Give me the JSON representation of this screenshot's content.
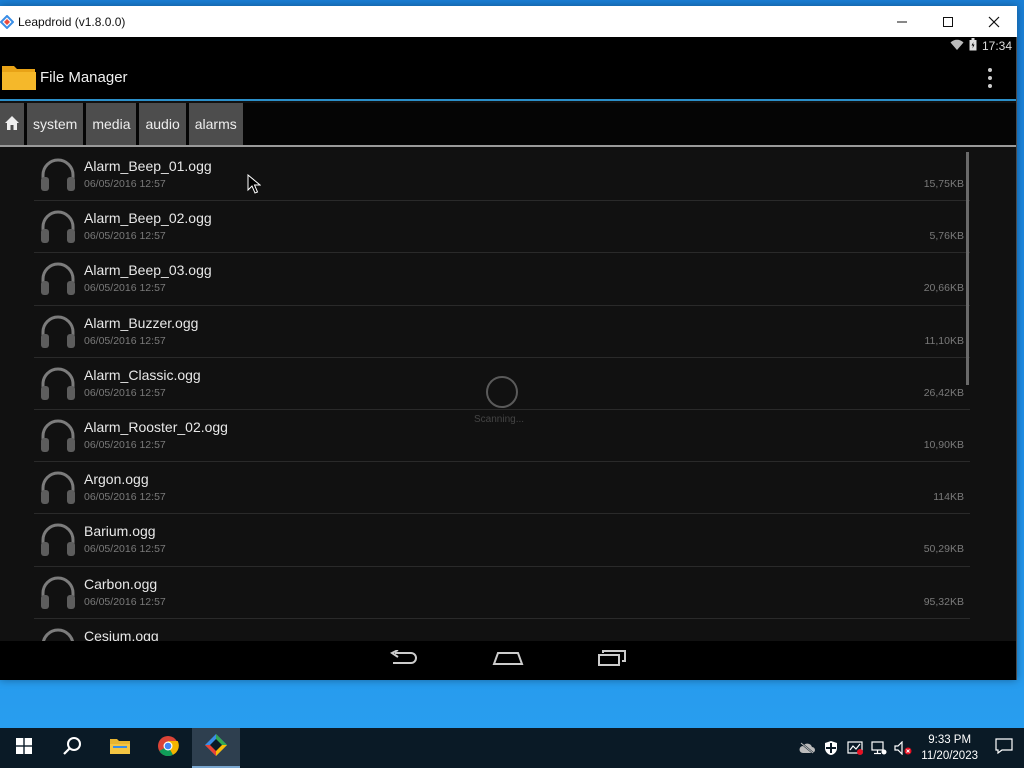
{
  "window": {
    "title": "Leapdroid (v1.8.0.0)",
    "controls": {
      "minimize": "─",
      "maximize": "☐",
      "close": "✕"
    }
  },
  "status_bar": {
    "time": "17:34"
  },
  "action_bar": {
    "title": "File Manager"
  },
  "breadcrumb": [
    "system",
    "media",
    "audio",
    "alarms"
  ],
  "files": [
    {
      "name": "Alarm_Beep_01.ogg",
      "date": "06/05/2016 12:57",
      "size": "15,75KB"
    },
    {
      "name": "Alarm_Beep_02.ogg",
      "date": "06/05/2016 12:57",
      "size": "5,76KB"
    },
    {
      "name": "Alarm_Beep_03.ogg",
      "date": "06/05/2016 12:57",
      "size": "20,66KB"
    },
    {
      "name": "Alarm_Buzzer.ogg",
      "date": "06/05/2016 12:57",
      "size": "11,10KB"
    },
    {
      "name": "Alarm_Classic.ogg",
      "date": "06/05/2016 12:57",
      "size": "26,42KB"
    },
    {
      "name": "Alarm_Rooster_02.ogg",
      "date": "06/05/2016 12:57",
      "size": "10,90KB"
    },
    {
      "name": "Argon.ogg",
      "date": "06/05/2016 12:57",
      "size": "114KB"
    },
    {
      "name": "Barium.ogg",
      "date": "06/05/2016 12:57",
      "size": "50,29KB"
    },
    {
      "name": "Carbon.ogg",
      "date": "06/05/2016 12:57",
      "size": "95,32KB"
    },
    {
      "name": "Cesium.ogg",
      "date": "",
      "size": ""
    }
  ],
  "scanning": "Scanning...",
  "taskbar": {
    "clock_time": "9:33 PM",
    "clock_date": "11/20/2023"
  }
}
